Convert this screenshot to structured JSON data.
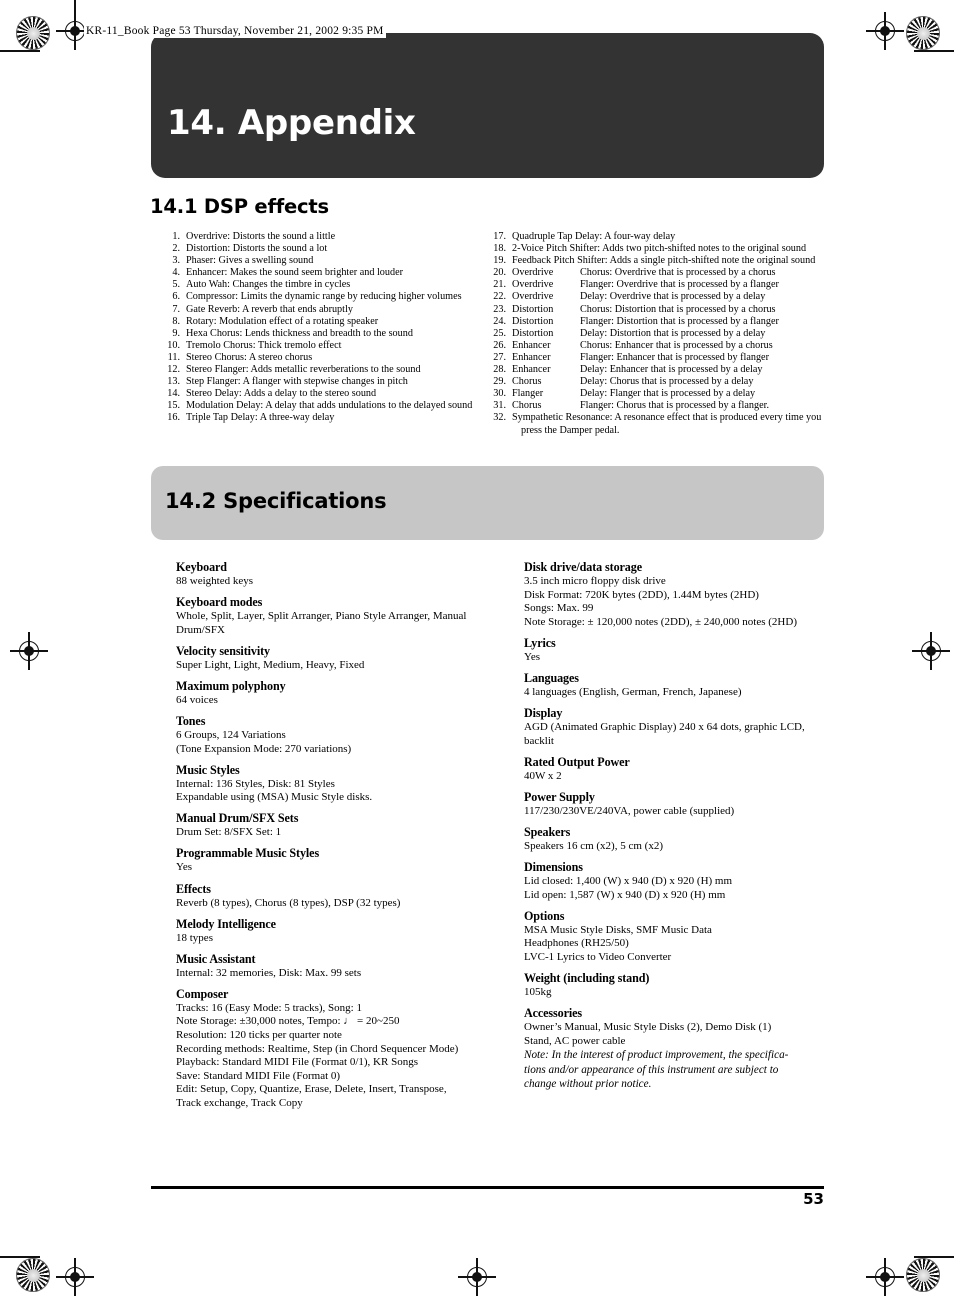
{
  "running_header": "KR-11_Book  Page 53  Thursday, November 21, 2002  9:35 PM",
  "chapter": {
    "title": "14. Appendix"
  },
  "sections": {
    "dsp": {
      "heading": "14.1 DSP effects",
      "items_left": [
        {
          "num": "1.",
          "text": "Overdrive: Distorts the sound a little"
        },
        {
          "num": "2.",
          "text": "Distortion: Distorts the sound a lot"
        },
        {
          "num": "3.",
          "text": "Phaser: Gives a swelling sound"
        },
        {
          "num": "4.",
          "text": "Enhancer: Makes the sound seem brighter and louder"
        },
        {
          "num": "5.",
          "text": "Auto Wah: Changes the timbre in cycles"
        },
        {
          "num": "6.",
          "text": "Compressor: Limits the dynamic range by reducing higher volumes"
        },
        {
          "num": "7.",
          "text": "Gate Reverb: A reverb that ends abruptly"
        },
        {
          "num": "8.",
          "text": "Rotary: Modulation effect of a rotating speaker"
        },
        {
          "num": "9.",
          "text": "Hexa Chorus: Lends thickness and breadth to the sound"
        },
        {
          "num": "10.",
          "text": "Tremolo Chorus: Thick tremolo effect"
        },
        {
          "num": "11.",
          "text": "Stereo Chorus: A stereo chorus"
        },
        {
          "num": "12.",
          "text": "Stereo Flanger: Adds metallic reverberations to the sound"
        },
        {
          "num": "13.",
          "text": "Step Flanger: A flanger with stepwise changes in pitch"
        },
        {
          "num": "14.",
          "text": "Stereo Delay: Adds a delay to the stereo sound"
        },
        {
          "num": "15.",
          "text": "Modulation Delay: A delay that adds undulations to the delayed sound"
        },
        {
          "num": "16.",
          "text": "Triple Tap Delay: A three-way delay"
        }
      ],
      "items_right": [
        {
          "num": "17.",
          "text": "Quadruple Tap Delay: A four-way delay"
        },
        {
          "num": "18.",
          "text": "2-Voice Pitch Shifter: Adds two pitch-shifted notes to the original sound"
        },
        {
          "num": "19.",
          "text": "Feedback Pitch Shifter: Adds a single pitch-shifted note the original sound"
        },
        {
          "num": "20.",
          "pre": "Overdrive",
          "text": "Chorus: Overdrive that is processed by a chorus"
        },
        {
          "num": "21.",
          "pre": "Overdrive",
          "text": "Flanger: Overdrive that is processed by a flanger"
        },
        {
          "num": "22.",
          "pre": "Overdrive",
          "text": "Delay: Overdrive that is processed by a delay"
        },
        {
          "num": "23.",
          "pre": "Distortion",
          "text": "Chorus: Distortion that is processed by a chorus"
        },
        {
          "num": "24.",
          "pre": "Distortion",
          "text": "Flanger: Distortion that is processed by a flanger"
        },
        {
          "num": "25.",
          "pre": "Distortion",
          "text": "Delay: Distortion that is processed by a delay"
        },
        {
          "num": "26.",
          "pre": "Enhancer",
          "text": "Chorus: Enhancer that is processed by a chorus"
        },
        {
          "num": "27.",
          "pre": "Enhancer",
          "text": "Flanger: Enhancer that is processed by flanger"
        },
        {
          "num": "28.",
          "pre": "Enhancer",
          "text": "Delay: Enhancer that is processed by a delay"
        },
        {
          "num": "29.",
          "pre": "Chorus",
          "text": "Delay: Chorus that is processed by a delay"
        },
        {
          "num": "30.",
          "pre": "Flanger",
          "text": "Delay: Flanger that is processed by a delay"
        },
        {
          "num": "31.",
          "pre": "Chorus",
          "text": "Flanger: Chorus that is processed by a flanger."
        },
        {
          "num": "32.",
          "text": "Sympathetic Resonance: A resonance effect that is produced every time you",
          "cont": "press the Damper pedal."
        }
      ]
    },
    "specs": {
      "heading": "14.2 Specifications",
      "left": [
        {
          "label": "Keyboard",
          "lines": [
            "88 weighted keys"
          ]
        },
        {
          "label": "Keyboard modes",
          "lines": [
            "Whole, Split, Layer, Split Arranger, Piano Style Arranger, Manual",
            "Drum/SFX"
          ]
        },
        {
          "label": "Velocity sensitivity",
          "lines": [
            "Super Light, Light, Medium, Heavy, Fixed"
          ]
        },
        {
          "label": "Maximum polyphony",
          "lines": [
            "64 voices"
          ]
        },
        {
          "label": "Tones",
          "lines": [
            "6 Groups, 124 Variations",
            "(Tone Expansion Mode: 270 variations)"
          ]
        },
        {
          "label": "Music Styles",
          "lines": [
            "Internal: 136 Styles, Disk: 81 Styles",
            "Expandable using (MSA) Music Style disks."
          ]
        },
        {
          "label": "Manual Drum/SFX Sets",
          "lines": [
            "Drum Set: 8/SFX Set: 1"
          ]
        },
        {
          "label": "Programmable Music Styles",
          "lines": [
            "Yes"
          ]
        },
        {
          "label": "Effects",
          "lines": [
            "Reverb (8 types), Chorus (8 types), DSP (32 types)"
          ]
        },
        {
          "label": "Melody Intelligence",
          "lines": [
            "18 types"
          ]
        },
        {
          "label": "Music Assistant",
          "lines": [
            "Internal: 32 memories, Disk: Max. 99 sets"
          ]
        },
        {
          "label": "Composer",
          "lines": [
            "Tracks: 16 (Easy Mode: 5 tracks), Song: 1",
            "Note Storage: ±30,000 notes, Tempo: ♩ = 20~250",
            "Resolution: 120 ticks per quarter note",
            "Recording methods: Realtime, Step (in Chord Sequencer Mode)",
            "Playback: Standard MIDI File (Format 0/1), KR Songs",
            "Save: Standard MIDI File (Format 0)",
            "Edit: Setup, Copy, Quantize, Erase, Delete, Insert, Transpose,",
            "Track exchange, Track Copy"
          ]
        }
      ],
      "right": [
        {
          "label": "Disk drive/data storage",
          "lines": [
            "3.5 inch micro floppy disk drive",
            "Disk Format: 720K bytes (2DD), 1.44M bytes (2HD)",
            "Songs: Max. 99",
            "Note Storage: ± 120,000 notes (2DD), ± 240,000 notes (2HD)"
          ]
        },
        {
          "label": "Lyrics",
          "lines": [
            "Yes"
          ]
        },
        {
          "label": "Languages",
          "lines": [
            "4 languages (English, German, French, Japanese)"
          ]
        },
        {
          "label": "Display",
          "lines": [
            "AGD (Animated Graphic Display) 240 x 64 dots, graphic LCD,",
            "backlit"
          ]
        },
        {
          "label": "Rated Output Power",
          "lines": [
            "40W x 2"
          ]
        },
        {
          "label": "Power Supply",
          "lines": [
            "117/230/230VE/240VA, power cable (supplied)"
          ]
        },
        {
          "label": "Speakers",
          "lines": [
            "Speakers 16 cm (x2), 5 cm (x2)"
          ]
        },
        {
          "label": "Dimensions",
          "lines": [
            "Lid closed: 1,400 (W) x 940 (D) x 920 (H) mm",
            "Lid open: 1,587 (W) x 940 (D) x 920 (H) mm"
          ]
        },
        {
          "label": "Options",
          "lines": [
            "MSA Music Style Disks, SMF Music Data",
            "Headphones (RH25/50)",
            "LVC-1 Lyrics to Video Converter"
          ]
        },
        {
          "label": "Weight (including stand)",
          "lines": [
            "105kg"
          ]
        },
        {
          "label": "Accessories",
          "lines": [
            "Owner’s Manual, Music Style Disks (2), Demo Disk (1)",
            "Stand, AC power cable"
          ],
          "note": [
            "Note: In the interest of product improvement, the specifica-",
            "tions and/or appearance of this instrument are subject to",
            "change without prior notice."
          ]
        }
      ]
    }
  },
  "footer": {
    "page_number": "53"
  }
}
